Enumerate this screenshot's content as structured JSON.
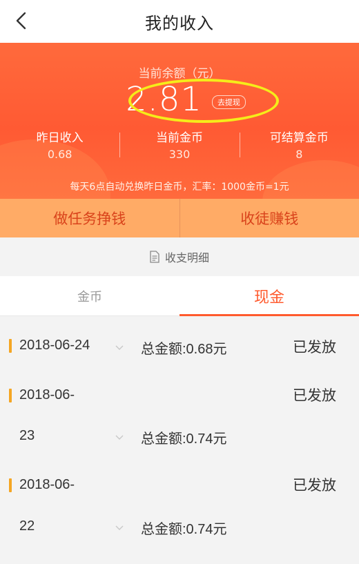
{
  "header": {
    "title": "我的收入"
  },
  "banner": {
    "balance_label": "当前余额（元）",
    "balance_value": "2.81",
    "withdraw_label": "去提现",
    "stats": [
      {
        "label": "昨日收入",
        "value": "0.68"
      },
      {
        "label": "当前金币",
        "value": "330"
      },
      {
        "label": "可结算金币",
        "value": "8"
      }
    ],
    "rate_note": "每天6点自动兑换昨日金币，汇率：1000金币=1元"
  },
  "actions": {
    "tasks_label": "做任务挣钱",
    "invite_label": "收徒赚钱"
  },
  "detail": {
    "label": "收支明细"
  },
  "tabs": {
    "coin": "金币",
    "cash": "现金"
  },
  "records": [
    {
      "date_line1": "2018-06-24",
      "date_line2": "",
      "amount": "总金额:0.68元",
      "status": "已发放"
    },
    {
      "date_line1": "2018-06-",
      "date_line2": "23",
      "amount": "总金额:0.74元",
      "status": "已发放"
    },
    {
      "date_line1": "2018-06-",
      "date_line2": "22",
      "amount": "总金额:0.74元",
      "status": "已发放"
    }
  ],
  "colors": {
    "brand_orange": "#ff5a2d",
    "banner_red": "#ff5a33",
    "highlight_yellow": "#f5ec1a",
    "action_bg": "#ffab66"
  }
}
